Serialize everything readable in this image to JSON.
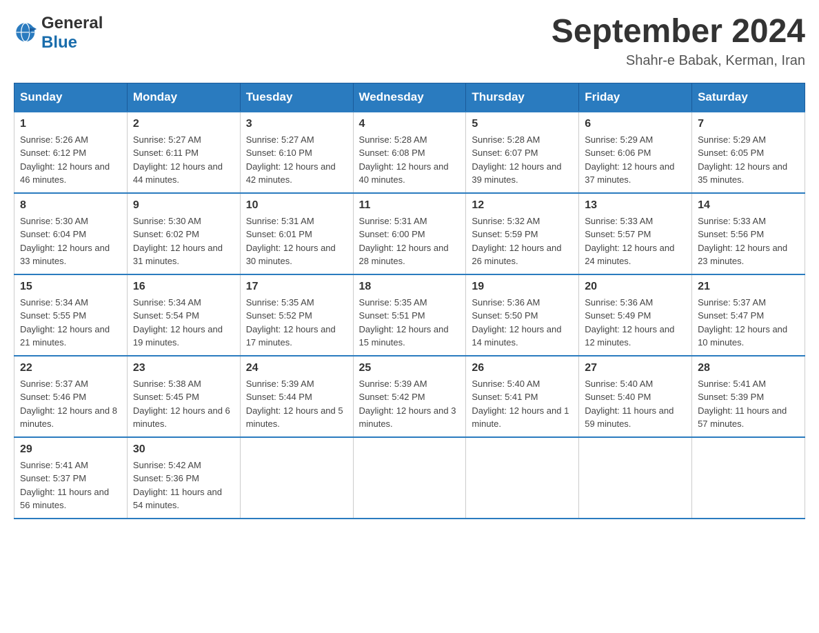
{
  "header": {
    "logo_line1": "General",
    "logo_line2": "Blue",
    "title": "September 2024",
    "subtitle": "Shahr-e Babak, Kerman, Iran"
  },
  "weekdays": [
    "Sunday",
    "Monday",
    "Tuesday",
    "Wednesday",
    "Thursday",
    "Friday",
    "Saturday"
  ],
  "weeks": [
    [
      {
        "day": "1",
        "sunrise": "5:26 AM",
        "sunset": "6:12 PM",
        "daylight": "12 hours and 46 minutes."
      },
      {
        "day": "2",
        "sunrise": "5:27 AM",
        "sunset": "6:11 PM",
        "daylight": "12 hours and 44 minutes."
      },
      {
        "day": "3",
        "sunrise": "5:27 AM",
        "sunset": "6:10 PM",
        "daylight": "12 hours and 42 minutes."
      },
      {
        "day": "4",
        "sunrise": "5:28 AM",
        "sunset": "6:08 PM",
        "daylight": "12 hours and 40 minutes."
      },
      {
        "day": "5",
        "sunrise": "5:28 AM",
        "sunset": "6:07 PM",
        "daylight": "12 hours and 39 minutes."
      },
      {
        "day": "6",
        "sunrise": "5:29 AM",
        "sunset": "6:06 PM",
        "daylight": "12 hours and 37 minutes."
      },
      {
        "day": "7",
        "sunrise": "5:29 AM",
        "sunset": "6:05 PM",
        "daylight": "12 hours and 35 minutes."
      }
    ],
    [
      {
        "day": "8",
        "sunrise": "5:30 AM",
        "sunset": "6:04 PM",
        "daylight": "12 hours and 33 minutes."
      },
      {
        "day": "9",
        "sunrise": "5:30 AM",
        "sunset": "6:02 PM",
        "daylight": "12 hours and 31 minutes."
      },
      {
        "day": "10",
        "sunrise": "5:31 AM",
        "sunset": "6:01 PM",
        "daylight": "12 hours and 30 minutes."
      },
      {
        "day": "11",
        "sunrise": "5:31 AM",
        "sunset": "6:00 PM",
        "daylight": "12 hours and 28 minutes."
      },
      {
        "day": "12",
        "sunrise": "5:32 AM",
        "sunset": "5:59 PM",
        "daylight": "12 hours and 26 minutes."
      },
      {
        "day": "13",
        "sunrise": "5:33 AM",
        "sunset": "5:57 PM",
        "daylight": "12 hours and 24 minutes."
      },
      {
        "day": "14",
        "sunrise": "5:33 AM",
        "sunset": "5:56 PM",
        "daylight": "12 hours and 23 minutes."
      }
    ],
    [
      {
        "day": "15",
        "sunrise": "5:34 AM",
        "sunset": "5:55 PM",
        "daylight": "12 hours and 21 minutes."
      },
      {
        "day": "16",
        "sunrise": "5:34 AM",
        "sunset": "5:54 PM",
        "daylight": "12 hours and 19 minutes."
      },
      {
        "day": "17",
        "sunrise": "5:35 AM",
        "sunset": "5:52 PM",
        "daylight": "12 hours and 17 minutes."
      },
      {
        "day": "18",
        "sunrise": "5:35 AM",
        "sunset": "5:51 PM",
        "daylight": "12 hours and 15 minutes."
      },
      {
        "day": "19",
        "sunrise": "5:36 AM",
        "sunset": "5:50 PM",
        "daylight": "12 hours and 14 minutes."
      },
      {
        "day": "20",
        "sunrise": "5:36 AM",
        "sunset": "5:49 PM",
        "daylight": "12 hours and 12 minutes."
      },
      {
        "day": "21",
        "sunrise": "5:37 AM",
        "sunset": "5:47 PM",
        "daylight": "12 hours and 10 minutes."
      }
    ],
    [
      {
        "day": "22",
        "sunrise": "5:37 AM",
        "sunset": "5:46 PM",
        "daylight": "12 hours and 8 minutes."
      },
      {
        "day": "23",
        "sunrise": "5:38 AM",
        "sunset": "5:45 PM",
        "daylight": "12 hours and 6 minutes."
      },
      {
        "day": "24",
        "sunrise": "5:39 AM",
        "sunset": "5:44 PM",
        "daylight": "12 hours and 5 minutes."
      },
      {
        "day": "25",
        "sunrise": "5:39 AM",
        "sunset": "5:42 PM",
        "daylight": "12 hours and 3 minutes."
      },
      {
        "day": "26",
        "sunrise": "5:40 AM",
        "sunset": "5:41 PM",
        "daylight": "12 hours and 1 minute."
      },
      {
        "day": "27",
        "sunrise": "5:40 AM",
        "sunset": "5:40 PM",
        "daylight": "11 hours and 59 minutes."
      },
      {
        "day": "28",
        "sunrise": "5:41 AM",
        "sunset": "5:39 PM",
        "daylight": "11 hours and 57 minutes."
      }
    ],
    [
      {
        "day": "29",
        "sunrise": "5:41 AM",
        "sunset": "5:37 PM",
        "daylight": "11 hours and 56 minutes."
      },
      {
        "day": "30",
        "sunrise": "5:42 AM",
        "sunset": "5:36 PM",
        "daylight": "11 hours and 54 minutes."
      },
      null,
      null,
      null,
      null,
      null
    ]
  ]
}
